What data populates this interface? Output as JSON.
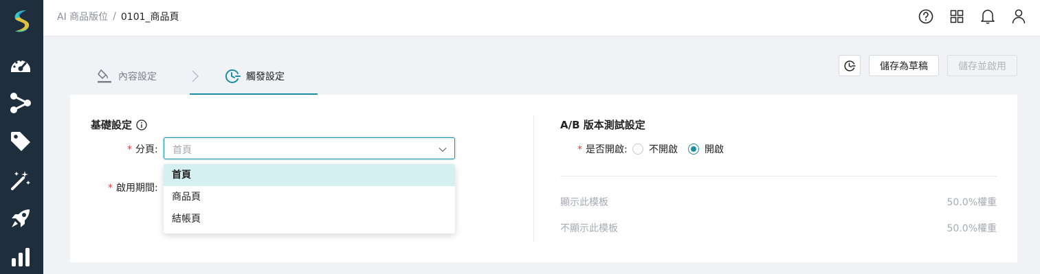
{
  "sidebar": {
    "items": [
      {
        "icon": "dashboard-gauge-icon"
      },
      {
        "icon": "flow-nodes-icon"
      },
      {
        "icon": "tag-icon"
      },
      {
        "icon": "magic-wand-icon"
      },
      {
        "icon": "rocket-icon"
      },
      {
        "icon": "bar-chart-icon"
      }
    ]
  },
  "header": {
    "breadcrumb_root": "AI 商品版位",
    "breadcrumb_sep": "/",
    "breadcrumb_current": "0101_商品頁",
    "icons": [
      "help-icon",
      "apps-grid-icon",
      "bell-icon",
      "user-icon"
    ]
  },
  "steps": {
    "content_label": "內容設定",
    "trigger_label": "觸發設定"
  },
  "toolbar": {
    "draft_label": "儲存為草稿",
    "publish_label": "儲存並啟用"
  },
  "basic": {
    "title": "基礎設定",
    "page_label": "分頁:",
    "page_placeholder": "首頁",
    "period_label": "啟用期間:",
    "options": [
      "首頁",
      "商品頁",
      "結帳頁"
    ]
  },
  "ab": {
    "title": "A/B 版本測試設定",
    "enable_label": "是否開啟:",
    "off_label": "不開啟",
    "on_label": "開啟",
    "show_label": "顯示此模板",
    "show_value": "50.0%權重",
    "hide_label": "不顯示此模板",
    "hide_value": "50.0%權重"
  },
  "colors": {
    "accent": "#1a8fa0",
    "sidebar": "#1f2e3d",
    "required": "#e0413a"
  }
}
